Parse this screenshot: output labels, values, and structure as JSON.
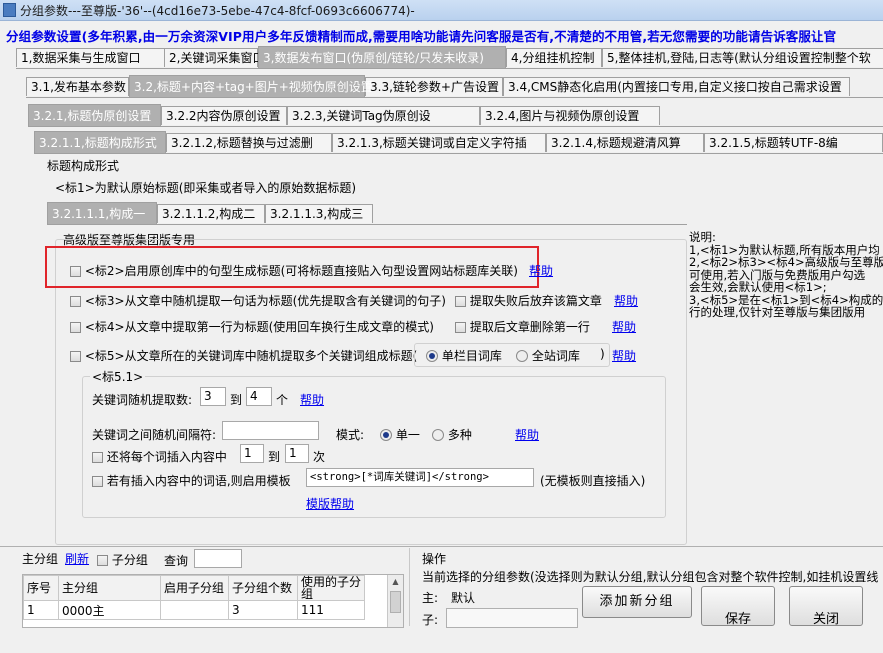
{
  "window": {
    "title": "分组参数---至尊版-'36'--(4cd16e73-5ebe-47c4-8fcf-0693c6606774)-"
  },
  "banner": "分组参数设置(多年积累,由一万余资深VIP用户多年反馈精制而成,需要用啥功能请先问客服是否有,不清楚的不用管,若无您需要的功能请告诉客服让官",
  "tabs_l1": [
    "1,数据采集与生成窗口",
    "2,关键词采集窗口",
    "3,数据发布窗口(伪原创/链轮/只发未收录)",
    "4,分组挂机控制",
    "5,整体挂机,登陆,日志等(默认分组设置控制整个软"
  ],
  "tabs_l2": [
    "3.1,发布基本参数",
    "3.2,标题+内容+tag+图片+视频伪原创设置",
    "3.3,链轮参数+广告设置",
    "3.4,CMS静态化启用(内置接口专用,自定义接口按自己需求设置"
  ],
  "tabs_l3": [
    "3.2.1,标题伪原创设置",
    "3.2.2内容伪原创设置",
    "3.2.3,关键词Tag伪原创设",
    "3.2.4,图片与视频伪原创设置"
  ],
  "tabs_l4": [
    "3.2.1.1,标题构成形式",
    "3.2.1.2,标题替换与过滤删",
    "3.2.1.3,标题关键词或自定义字符插",
    "3.2.1.4,标题规避清风算",
    "3.2.1.5,标题转UTF-8编"
  ],
  "section": {
    "label": "标题构成形式",
    "note": "<标1>为默认原始标题(即采集或者导入的原始数据标题)"
  },
  "tabs_l5": [
    "3.2.1.1.1,构成一",
    "3.2.1.1.2,构成二",
    "3.2.1.1.3,构成三"
  ],
  "premium": {
    "label": "高级版至尊版集团版专用",
    "opt2": "<标2>启用原创库中的句型生成标题(可将标题直接贴入句型设置网站标题库关联)",
    "opt3": "<标3>从文章中随机提取一句话为标题(优先提取含有关键词的句子)",
    "opt3b": "提取失败后放弃该篇文章",
    "opt4": "<标4>从文章中提取第一行为标题(使用回车换行生成文章的模式)",
    "opt4b": "提取后文章删除第一行",
    "opt5": "<标5>从文章所在的关键词库中随机提取多个关键词组成标题(",
    "opt5_r1": "单栏目词库",
    "opt5_r2": "全站词库",
    "opt5_close": ")",
    "help": "帮助"
  },
  "biao51": {
    "label": "<标5.1>",
    "kw_count_label": "关键词随机提取数:",
    "kw_min": "3",
    "to": "到",
    "kw_max": "4",
    "unit": "个",
    "sep_label": "关键词之间随机间隔符:",
    "sep_value": "",
    "mode_label": "模式:",
    "mode_single": "单一",
    "mode_multi": "多种",
    "insert_label": "还将每个词插入内容中",
    "ins_min": "1",
    "ins_max": "1",
    "times": "次",
    "tpl_label": "若有插入内容中的词语,则启用模板",
    "tpl_value": "<strong>[*词库关键词]</strong>",
    "tpl_note": "(无模板则直接插入)",
    "tpl_help": "模版帮助"
  },
  "explain": {
    "title": "说明:",
    "lines": [
      "1,<标1>为默认标题,所有版本用户均",
      "2,<标2>标3><标4>高级版与至尊版与",
      "   可使用,若入门版与免费版用户勾选",
      "   会生效,会默认使用<标1>;",
      "3,<标5>是在<标1>到<标4>构成的标题",
      "   行的处理,仅针对至尊版与集团版用"
    ]
  },
  "bottom": {
    "group_label": "主分组",
    "refresh": "刷新",
    "subgroup": "子分组",
    "query": "查询",
    "columns": [
      "序号",
      "主分组",
      "启用子分组",
      "子分组个数",
      "使用的子分组"
    ],
    "rows": [
      [
        "1",
        "0000主",
        "",
        "3",
        "111"
      ]
    ],
    "ops_title": "操作",
    "ops_note": "当前选择的分组参数(没选择则为默认分组,默认分组包含对整个软件控制,如挂机设置线",
    "main_label": "主:",
    "main_value": "默认",
    "sub_label": "子:",
    "add_btn": "添加新分组",
    "save_btn": "保存",
    "close_btn": "关闭"
  },
  "colors": {
    "banner": "#0000e6",
    "highlight": "#e0242a",
    "link": "#0000ee"
  }
}
